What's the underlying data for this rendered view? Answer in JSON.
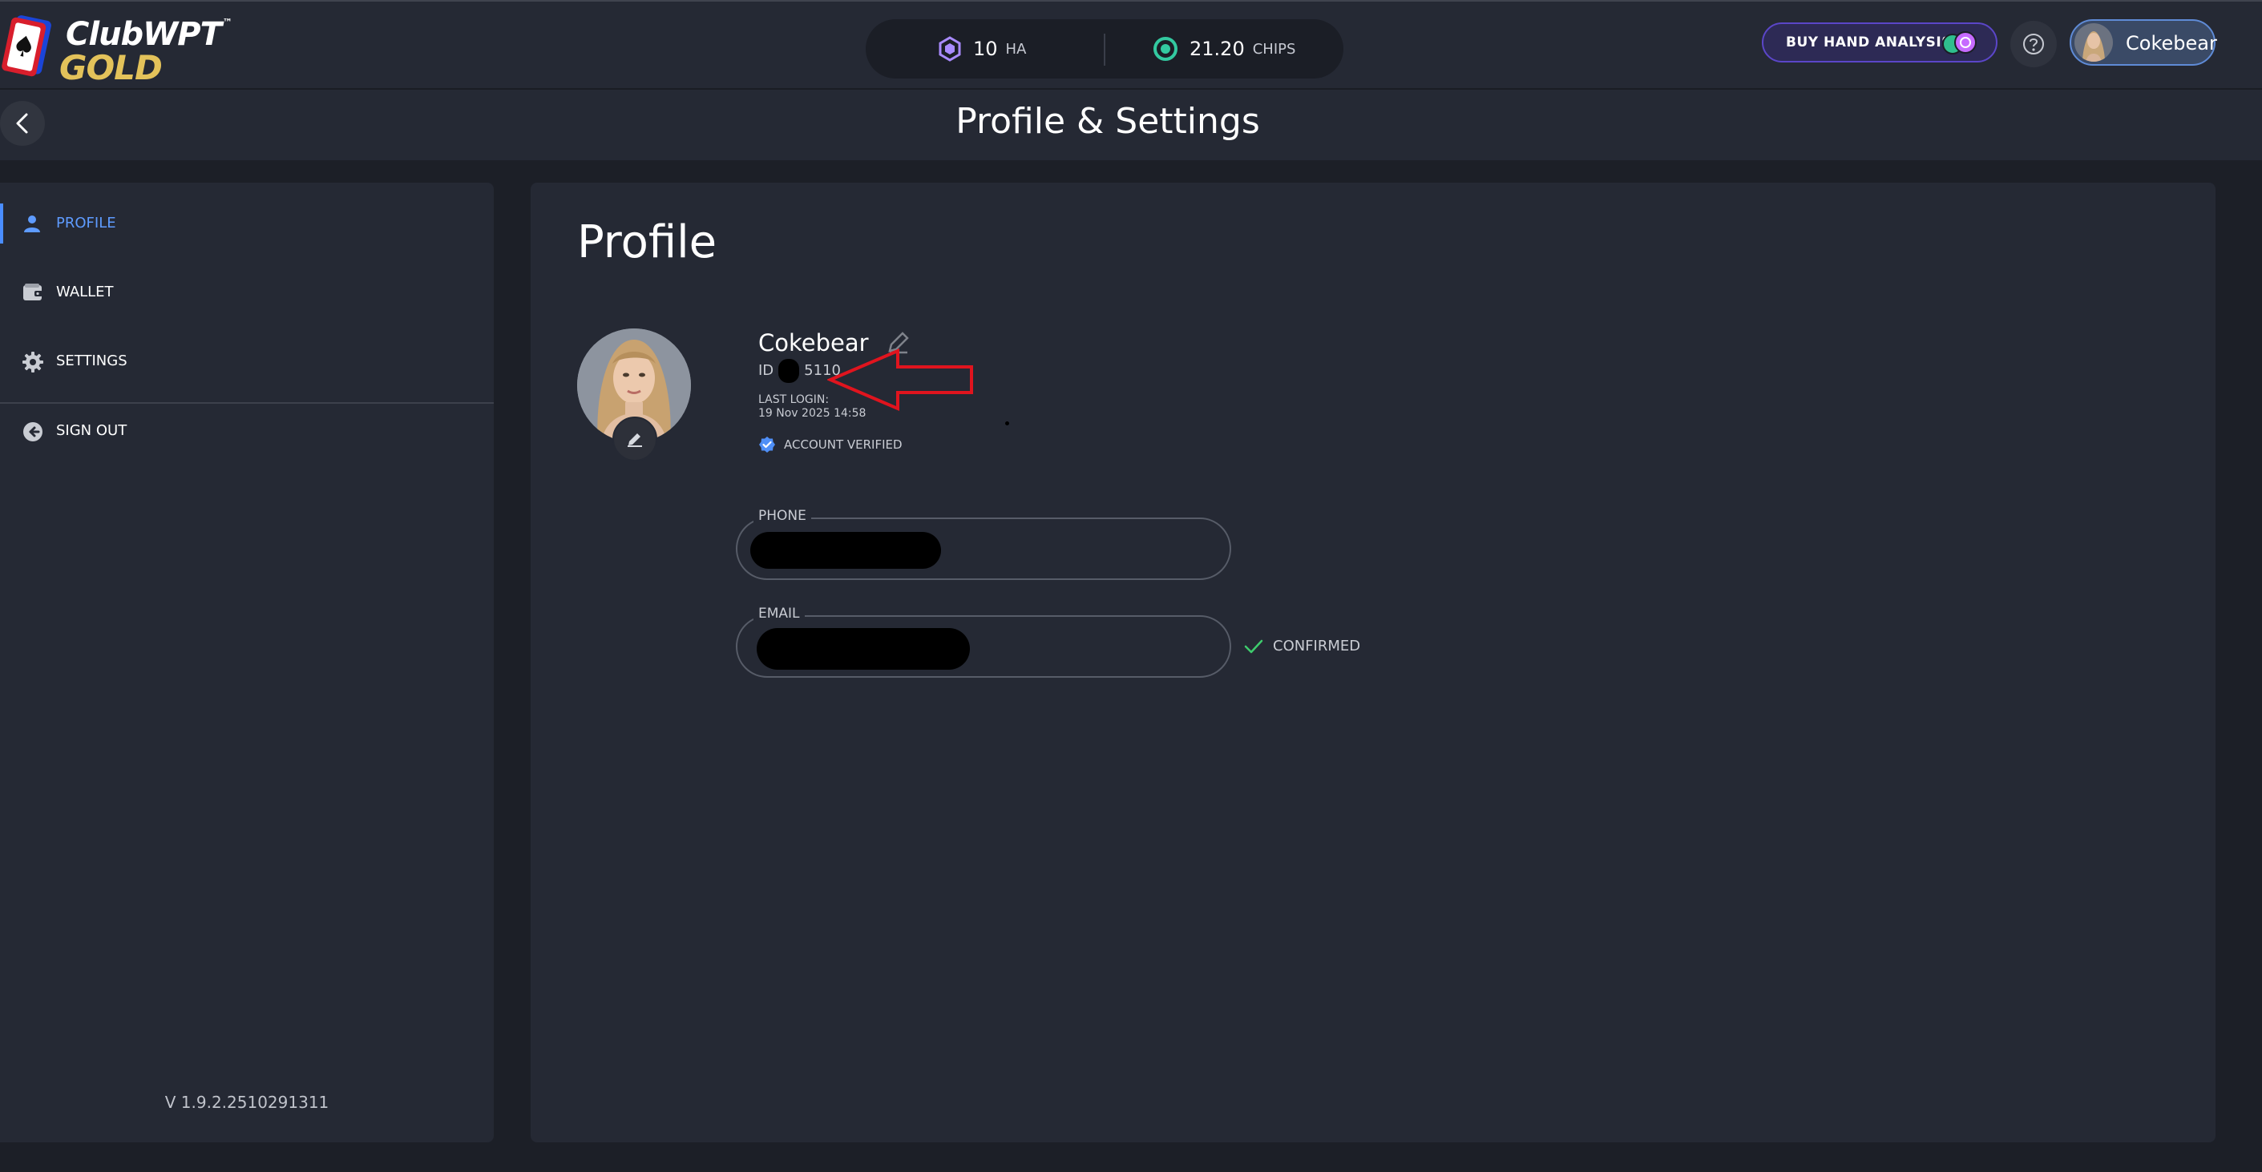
{
  "header": {
    "logo_line1": "ClubWPT",
    "logo_tm": "™",
    "logo_line2": "GOLD",
    "ha_balance": "10",
    "ha_unit": "HA",
    "chips_balance": "21.20",
    "chips_unit": "CHIPS",
    "buy_button_label": "BUY HAND ANALYSIS",
    "username": "Cokebear",
    "ha_icon": "hexagon-ha-icon",
    "chips_icon": "chip-icon",
    "help_icon": "question-circle-icon"
  },
  "titlebar": {
    "title": "Profile & Settings",
    "back_icon": "chevron-left-icon"
  },
  "sidebar": {
    "items": [
      {
        "label": "PROFILE",
        "icon": "user-icon",
        "active": true
      },
      {
        "label": "WALLET",
        "icon": "wallet-icon",
        "active": false
      },
      {
        "label": "SETTINGS",
        "icon": "gear-icon",
        "active": false
      },
      {
        "label": "SIGN OUT",
        "icon": "sign-out-icon",
        "active": false
      }
    ],
    "version": "V 1.9.2.2510291311"
  },
  "profile": {
    "heading": "Profile",
    "username": "Cokebear",
    "id_prefix": "ID",
    "id_suffix": "5110",
    "last_login_label": "LAST LOGIN:",
    "last_login_value": "19 Nov 2025 14:58",
    "verified_label": "ACCOUNT VERIFIED",
    "phone_label": "PHONE",
    "email_label": "EMAIL",
    "email_status": "CONFIRMED"
  },
  "colors": {
    "background": "#1c1f27",
    "panel": "#252934",
    "accent_blue": "#4a8dff",
    "buy_button_border": "#5b46c8",
    "annotation_red": "#e0141e",
    "confirmed_green": "#3ecb6d"
  }
}
